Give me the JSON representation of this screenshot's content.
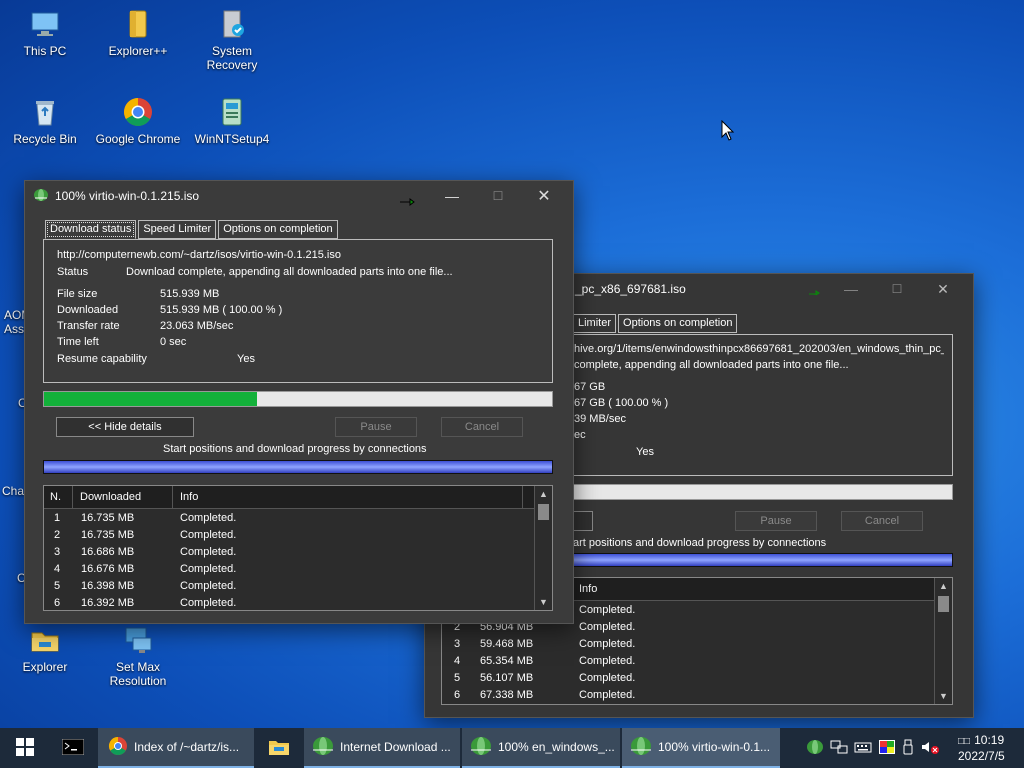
{
  "desktop": {
    "icons": [
      {
        "label": "This PC"
      },
      {
        "label": "Explorer++"
      },
      {
        "label": "System Recovery"
      },
      {
        "label": "Recycle Bin"
      },
      {
        "label": "Google Chrome"
      },
      {
        "label": "WinNTSetup4"
      },
      {
        "label": "Explorer"
      },
      {
        "label": "Set Max Resolution"
      }
    ],
    "partial_labels": [
      "AOM",
      "Ass",
      "C",
      "Cha",
      "C"
    ]
  },
  "back_window": {
    "title": "_pc_x86_697681.iso",
    "tabs": [
      "Limiter",
      "Options on completion"
    ],
    "url": "hive.org/1/items/enwindowsthinpcx86697681_202003/en_windows_thin_pc_",
    "status": "complete, appending all downloaded parts into one file...",
    "file_size": "67 GB",
    "downloaded": "67 GB  ( 100.00 % )",
    "transfer_rate": "39  MB/sec",
    "time_left": "ec",
    "resume": "Yes",
    "pause_label": "Pause",
    "cancel_label": "Cancel",
    "conn_caption": "art positions and download progress by connections",
    "list_header_info": "Info",
    "rows": [
      {
        "n": "",
        "downloaded": "",
        "info": "Completed."
      },
      {
        "n": "2",
        "downloaded": "56.904  MB",
        "info": "Completed."
      },
      {
        "n": "3",
        "downloaded": "59.468  MB",
        "info": "Completed."
      },
      {
        "n": "4",
        "downloaded": "65.354  MB",
        "info": "Completed."
      },
      {
        "n": "5",
        "downloaded": "56.107  MB",
        "info": "Completed."
      },
      {
        "n": "6",
        "downloaded": "67.338  MB",
        "info": "Completed."
      }
    ]
  },
  "front_window": {
    "title": "100% virtio-win-0.1.215.iso",
    "tabs": [
      "Download status",
      "Speed Limiter",
      "Options on completion"
    ],
    "url": "http://computernewb.com/~dartz/isos/virtio-win-0.1.215.iso",
    "status_label": "Status",
    "status_value": "Download complete, appending all downloaded parts into one file...",
    "file_size_label": "File size",
    "file_size": "515.939  MB",
    "downloaded_label": "Downloaded",
    "downloaded": "515.939  MB  ( 100.00 % )",
    "transfer_rate_label": "Transfer rate",
    "transfer_rate": "23.063  MB/sec",
    "time_left_label": "Time left",
    "time_left": "0 sec",
    "resume_label": "Resume capability",
    "resume": "Yes",
    "progress_fraction": 0.42,
    "hide_details_label": "<< Hide details",
    "pause_label": "Pause",
    "cancel_label": "Cancel",
    "conn_caption": "Start positions and download progress by connections",
    "list_headers": [
      "N.",
      "Downloaded",
      "Info"
    ],
    "rows": [
      {
        "n": "1",
        "downloaded": "16.735  MB",
        "info": "Completed."
      },
      {
        "n": "2",
        "downloaded": "16.735  MB",
        "info": "Completed."
      },
      {
        "n": "3",
        "downloaded": "16.686  MB",
        "info": "Completed."
      },
      {
        "n": "4",
        "downloaded": "16.676  MB",
        "info": "Completed."
      },
      {
        "n": "5",
        "downloaded": "16.398  MB",
        "info": "Completed."
      },
      {
        "n": "6",
        "downloaded": "16.392  MB",
        "info": "Completed."
      }
    ]
  },
  "taskbar": {
    "items": [
      {
        "label": "Index of /~dartz/is..."
      },
      {
        "label": "Internet Download ..."
      },
      {
        "label": "100% en_windows_..."
      },
      {
        "label": "100% virtio-win-0.1..."
      }
    ],
    "ime": "□□",
    "time": "10:19",
    "date": "2022/7/5"
  },
  "colors": {
    "progress_fill": "#13b13a",
    "window_bg": "#3b3b3b",
    "taskbar_bg": "#1d2a3a"
  }
}
